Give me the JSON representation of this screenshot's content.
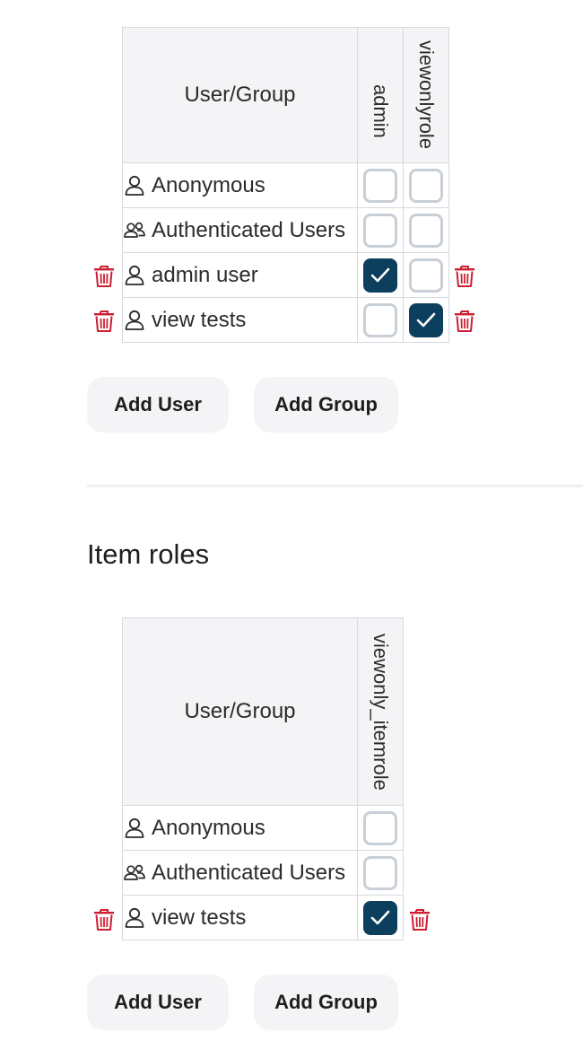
{
  "icon_names": {
    "user": "user-icon",
    "group": "group-icon",
    "delete": "trash-icon",
    "check": "check-icon"
  },
  "colors": {
    "checked_bg": "#0c3e5e",
    "unchecked_border": "#c9cfd6",
    "trash": "#cc1f33",
    "header_bg": "#f4f4f7",
    "button_bg": "#f4f4f7"
  },
  "collection_roles": {
    "corner_label": "User/Group",
    "roles": [
      "admin",
      "viewonlyrole"
    ],
    "rows": [
      {
        "name": "Anonymous",
        "kind": "user",
        "checks": [
          false,
          false
        ]
      },
      {
        "name": "Authenticated Users",
        "kind": "group",
        "checks": [
          false,
          false
        ]
      },
      {
        "name": "admin user",
        "kind": "user",
        "checks": [
          true,
          false
        ]
      },
      {
        "name": "view tests",
        "kind": "user",
        "checks": [
          false,
          true
        ]
      }
    ],
    "add_user_label": "Add User",
    "add_group_label": "Add Group"
  },
  "item_roles": {
    "heading": "Item roles",
    "corner_label": "User/Group",
    "roles": [
      "viewonly_itemrole"
    ],
    "rows": [
      {
        "name": "Anonymous",
        "kind": "user",
        "checks": [
          false
        ]
      },
      {
        "name": "Authenticated Users",
        "kind": "group",
        "checks": [
          false
        ]
      },
      {
        "name": "view tests",
        "kind": "user",
        "checks": [
          true
        ]
      }
    ],
    "add_user_label": "Add User",
    "add_group_label": "Add Group"
  }
}
